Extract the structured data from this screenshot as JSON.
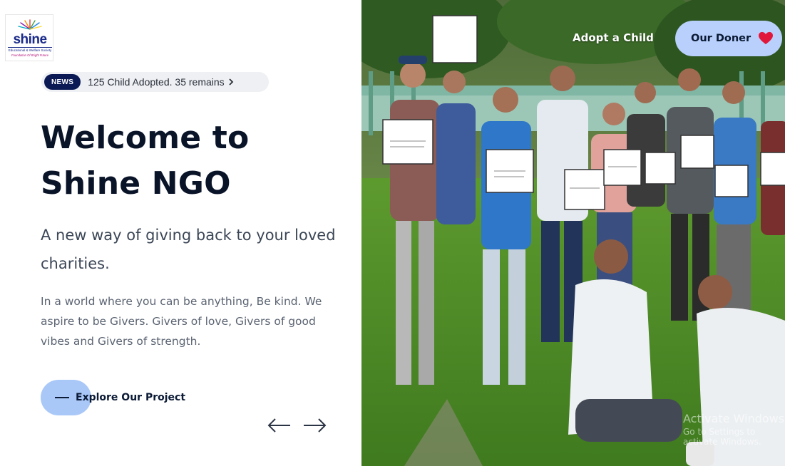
{
  "logo": {
    "word": "shine",
    "line1": "Educational & Welfare Society",
    "line2": "Foundation Of Bright Future"
  },
  "news": {
    "badge": "NEWS",
    "text": "125 Child Adopted. 35 remains"
  },
  "hero": {
    "headline_line1": "Welcome to",
    "headline_line2": "Shine NGO",
    "subhead": "A new way of giving back to your loved charities.",
    "body": "In a world where you can be anything, Be kind. We aspire to be Givers. Givers of love, Givers of good vibes and Givers of strength.",
    "cta_label": "Explore Our Project"
  },
  "nav": {
    "adopt_label": "Adopt a Child",
    "doner_label": "Our Doner"
  },
  "watermark": {
    "line1": "Activate Windows",
    "line2": "Go to Settings to activate Windows."
  },
  "colors": {
    "navy": "#0b1a55",
    "accent_blue": "#a9c8f8",
    "heart": "#e0173b"
  }
}
